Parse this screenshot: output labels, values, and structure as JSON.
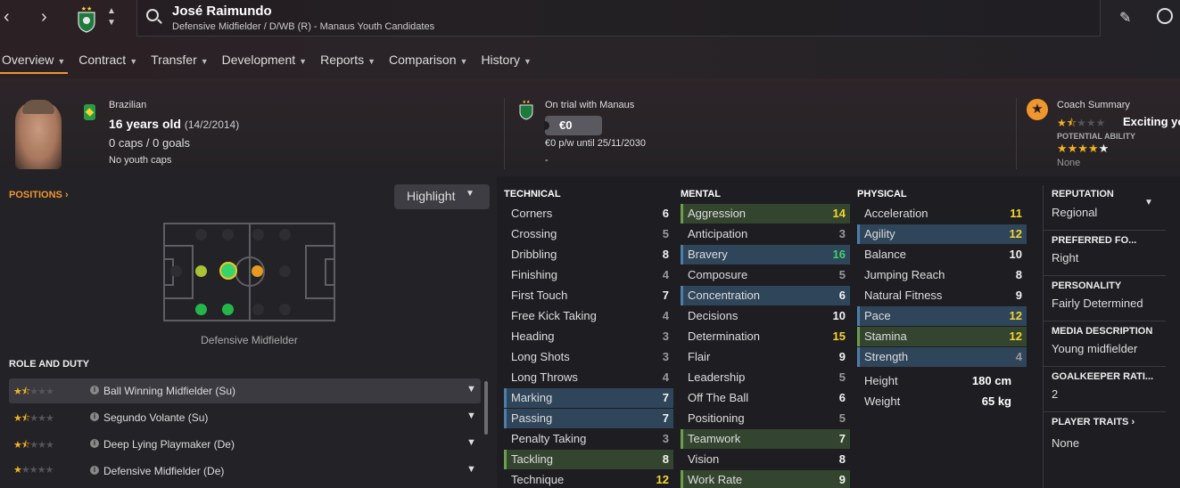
{
  "header": {
    "name": "José Raimundo",
    "subtitle": "Defensive Midfielder / D/WB (R) - Manaus Youth Candidates"
  },
  "tabs": [
    {
      "label": "Overview"
    },
    {
      "label": "Contract"
    },
    {
      "label": "Transfer"
    },
    {
      "label": "Development"
    },
    {
      "label": "Reports"
    },
    {
      "label": "Comparison"
    },
    {
      "label": "History"
    }
  ],
  "info": {
    "nationality": "Brazilian",
    "age": "16 years old",
    "dob": "(14/2/2014)",
    "caps": "0 caps / 0 goals",
    "youth_caps": "No youth caps",
    "trial": "On trial with Manaus",
    "value": "€0",
    "wage": "€0 p/w until 25/11/2030",
    "dash": "-",
    "coach_title": "Coach Summary",
    "coach_verdict": "Exciting yo",
    "current_ability_stars": 1.5,
    "potential_label": "POTENTIAL ABILITY",
    "potential_ability_stars": 4,
    "potential_note": "None"
  },
  "positions": {
    "heading": "POSITIONS",
    "highlight_label": "Highlight",
    "caption": "Defensive Midfielder"
  },
  "roles": {
    "heading": "ROLE AND DUTY",
    "items": [
      {
        "name": "Ball Winning Midfielder (Su)",
        "stars": 1.5
      },
      {
        "name": "Segundo Volante (Su)",
        "stars": 1.5
      },
      {
        "name": "Deep Lying Playmaker (De)",
        "stars": 1.5
      },
      {
        "name": "Defensive Midfielder (De)",
        "stars": 1
      }
    ]
  },
  "technical": {
    "title": "TECHNICAL",
    "items": [
      {
        "name": "Corners",
        "value": "6"
      },
      {
        "name": "Crossing",
        "value": "5"
      },
      {
        "name": "Dribbling",
        "value": "8"
      },
      {
        "name": "Finishing",
        "value": "4"
      },
      {
        "name": "First Touch",
        "value": "7"
      },
      {
        "name": "Free Kick Taking",
        "value": "4"
      },
      {
        "name": "Heading",
        "value": "3"
      },
      {
        "name": "Long Shots",
        "value": "3"
      },
      {
        "name": "Long Throws",
        "value": "4"
      },
      {
        "name": "Marking",
        "value": "7"
      },
      {
        "name": "Passing",
        "value": "7"
      },
      {
        "name": "Penalty Taking",
        "value": "3"
      },
      {
        "name": "Tackling",
        "value": "8"
      },
      {
        "name": "Technique",
        "value": "12"
      }
    ]
  },
  "mental": {
    "title": "MENTAL",
    "items": [
      {
        "name": "Aggression",
        "value": "14"
      },
      {
        "name": "Anticipation",
        "value": "3"
      },
      {
        "name": "Bravery",
        "value": "16"
      },
      {
        "name": "Composure",
        "value": "5"
      },
      {
        "name": "Concentration",
        "value": "6"
      },
      {
        "name": "Decisions",
        "value": "10"
      },
      {
        "name": "Determination",
        "value": "15"
      },
      {
        "name": "Flair",
        "value": "9"
      },
      {
        "name": "Leadership",
        "value": "5"
      },
      {
        "name": "Off The Ball",
        "value": "6"
      },
      {
        "name": "Positioning",
        "value": "5"
      },
      {
        "name": "Teamwork",
        "value": "7"
      },
      {
        "name": "Vision",
        "value": "8"
      },
      {
        "name": "Work Rate",
        "value": "9"
      }
    ]
  },
  "physical": {
    "title": "PHYSICAL",
    "items": [
      {
        "name": "Acceleration",
        "value": "11"
      },
      {
        "name": "Agility",
        "value": "12"
      },
      {
        "name": "Balance",
        "value": "10"
      },
      {
        "name": "Jumping Reach",
        "value": "8"
      },
      {
        "name": "Natural Fitness",
        "value": "9"
      },
      {
        "name": "Pace",
        "value": "12"
      },
      {
        "name": "Stamina",
        "value": "12"
      },
      {
        "name": "Strength",
        "value": "4"
      }
    ],
    "height_label": "Height",
    "height": "180 cm",
    "weight_label": "Weight",
    "weight": "65 kg"
  },
  "side": {
    "reputation_title": "REPUTATION",
    "reputation": "Regional",
    "foot_title": "PREFERRED FO...",
    "foot": "Right",
    "personality_title": "PERSONALITY",
    "personality": "Fairly Determined",
    "media_title": "MEDIA DESCRIPTION",
    "media": "Young midfielder",
    "gk_title": "GOALKEEPER RATI...",
    "gk": "2",
    "traits_title": "PLAYER TRAITS",
    "traits": "None"
  },
  "colors": {
    "accent": "#f0962e",
    "value_great": "#3ed06f",
    "value_good": "#f5d630",
    "highlight_blue": "#2f4559",
    "highlight_green": "#34452f"
  }
}
